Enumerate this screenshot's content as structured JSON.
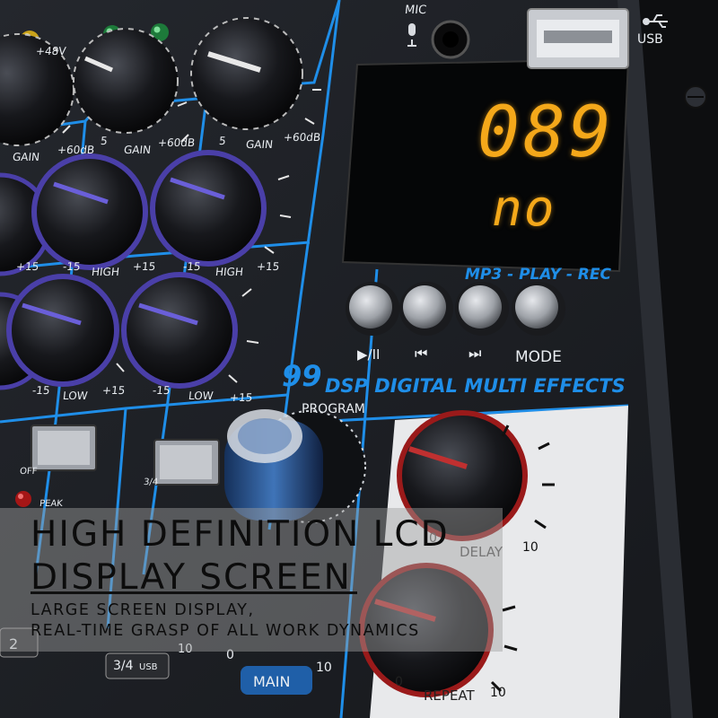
{
  "caption": {
    "title_line1": "HIGH DEFINITION LCD",
    "title_line2": "DISPLAY SCREEN",
    "subtitle_line1": "LARGE SCREEN DISPLAY,",
    "subtitle_line2": "REAL-TIME GRASP OF ALL WORK DYNAMICS"
  },
  "io": {
    "mic_label": "MIC",
    "usb_label": "USB"
  },
  "lcd": {
    "track_number": "089",
    "status": "no"
  },
  "player": {
    "header": "MP3 - PLAY - REC",
    "buttons": [
      "▶/II",
      "⏮",
      "⏭",
      "MODE"
    ]
  },
  "effects": {
    "count": "99",
    "label": "DSP DIGITAL MULTI EFFECTS",
    "program_label": "PROGRAM",
    "delay_label": "DELAY",
    "repeat_label": "REPEAT",
    "scale_min": "0",
    "scale_max": "10"
  },
  "channels": {
    "phantom_label": "+48V",
    "gain_label": "GAIN",
    "gain_min": "5",
    "gain_max": "+60dB",
    "eq_min": "-15",
    "eq_max": "+15",
    "high_label": "HIGH",
    "low_label": "LOW",
    "off_label": "OFF",
    "peak_label": "PEAK",
    "channel_2": "2",
    "bus_34": "3/4",
    "usb_suffix": "USB",
    "main_label": "MAIN",
    "fader_max": "10",
    "fader_min": "0"
  },
  "colors": {
    "accent_blue": "#1f8ee8",
    "lcd_amber": "#f4a81a",
    "knob_purple": "#4a3fa8",
    "knob_red": "#9a1a1a",
    "panel": "#1a1c20"
  }
}
